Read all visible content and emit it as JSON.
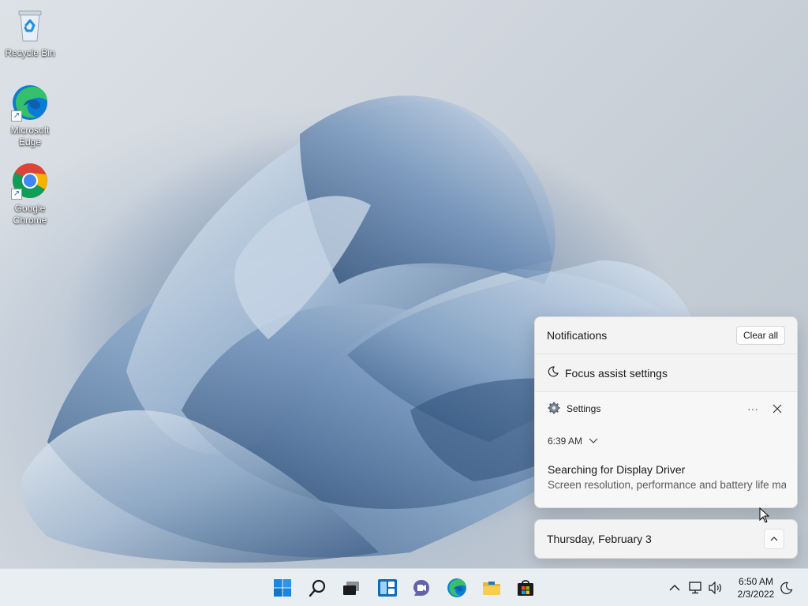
{
  "desktop": {
    "icons": [
      {
        "label": "Recycle Bin",
        "icon": "recycle-bin-icon"
      },
      {
        "label": "Microsoft Edge",
        "icon": "edge-icon"
      },
      {
        "label": "Google Chrome",
        "icon": "chrome-icon"
      }
    ]
  },
  "notifications": {
    "title": "Notifications",
    "clear_all": "Clear all",
    "focus_assist": "Focus assist settings",
    "card": {
      "app": "Settings",
      "more": "···",
      "time": "6:39 AM",
      "title": "Searching for Display Driver",
      "body": "Screen resolution, performance and battery life may be limited"
    }
  },
  "calendar": {
    "date_label": "Thursday, February 3"
  },
  "taskbar": {
    "apps": [
      "start-icon",
      "search-icon",
      "task-view-icon",
      "widgets-icon",
      "teams-chat-icon",
      "edge-icon",
      "file-explorer-icon",
      "store-icon"
    ],
    "clock_time": "6:50 AM",
    "clock_date": "2/3/2022"
  },
  "colors": {
    "accent": "#0078d4",
    "taskbar_bg": "#e9eef3",
    "panel_bg": "#f3f3f3"
  }
}
